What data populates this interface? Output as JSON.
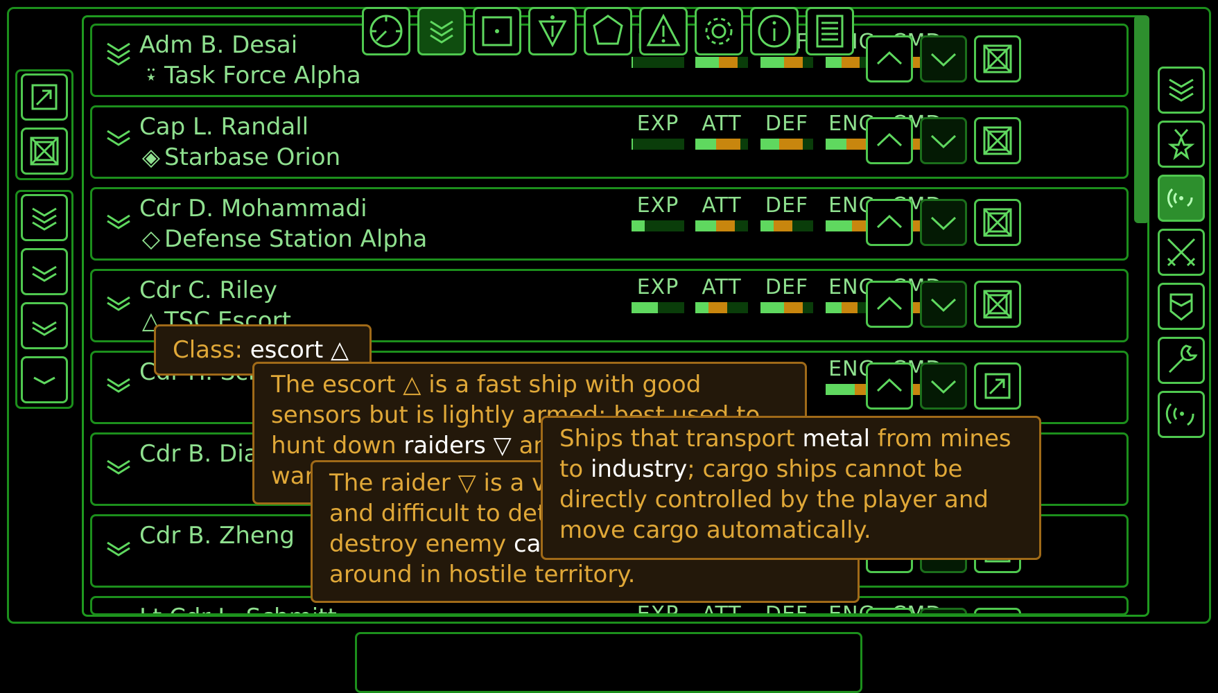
{
  "roster": [
    {
      "name": "Adm B. Desai",
      "unit_icon": "admiral-triangle-icon",
      "unit_glyph": "⍣",
      "unit": "Task Force Alpha",
      "chevron": "triple-chevron-icon",
      "last_button": "remove-square-icon",
      "stats": {
        "EXP": [
          0.02,
          0
        ],
        "ATT": [
          0.45,
          0.35
        ],
        "DEF": [
          0.45,
          0.35
        ],
        "ENG": [
          0.3,
          0.35
        ],
        "CMD": [
          0.35,
          0.35
        ]
      }
    },
    {
      "name": "Cap L. Randall",
      "unit_icon": "starbase-icon",
      "unit_glyph": "◈",
      "unit": "Starbase Orion",
      "chevron": "double-chevron-icon",
      "last_button": "remove-square-icon",
      "stats": {
        "EXP": [
          0.02,
          0
        ],
        "ATT": [
          0.4,
          0.45
        ],
        "DEF": [
          0.35,
          0.45
        ],
        "ENG": [
          0.4,
          0.45
        ],
        "CMD": [
          0.4,
          0.45
        ]
      }
    },
    {
      "name": "Cdr D. Mohammadi",
      "unit_icon": "defense-station-icon",
      "unit_glyph": "◇",
      "unit": "Defense Station Alpha",
      "chevron": "single-chevron-icon",
      "last_button": "remove-square-icon",
      "stats": {
        "EXP": [
          0.25,
          0
        ],
        "ATT": [
          0.4,
          0.35
        ],
        "DEF": [
          0.25,
          0.35
        ],
        "ENG": [
          0.5,
          0.35
        ],
        "CMD": [
          0.4,
          0.35
        ]
      }
    },
    {
      "name": "Cdr C. Riley",
      "unit_icon": "escort-icon",
      "unit_glyph": "△",
      "unit": "TSC Escort",
      "chevron": "single-chevron-icon",
      "last_button": "remove-square-icon",
      "stats": {
        "EXP": [
          0.5,
          0
        ],
        "ATT": [
          0.25,
          0.35
        ],
        "DEF": [
          0.45,
          0.35
        ],
        "ENG": [
          0.3,
          0.3
        ],
        "CMD": [
          0.35,
          0.3
        ]
      }
    },
    {
      "name": "Cdr H. Sch",
      "unit_icon": "",
      "unit_glyph": "",
      "unit": "",
      "chevron": "single-chevron-icon",
      "last_button": "assign-arrow-icon",
      "stats": {
        "ENG": [
          0.55,
          0.25
        ],
        "CMD": [
          0.35,
          0.35
        ]
      }
    },
    {
      "name": "Cdr B. Dias",
      "unit_icon": "",
      "unit_glyph": "",
      "unit": "",
      "chevron": "single-chevron-icon",
      "last_button": "assign-arrow-icon",
      "stats": {}
    },
    {
      "name": "Cdr B. Zheng",
      "unit_icon": "",
      "unit_glyph": "",
      "unit": "",
      "chevron": "single-chevron-icon",
      "last_button": "assign-arrow-icon",
      "stats": {}
    },
    {
      "name": "Lt Cdr L. Schmitt",
      "unit_icon": "",
      "unit_glyph": "",
      "unit": "",
      "chevron": "single-chevron-icon",
      "last_button": "assign-arrow-icon",
      "stats": {
        "EXP": [
          0,
          0
        ],
        "ATT": [
          0,
          0
        ],
        "DEF": [
          0,
          0
        ],
        "ENG": [
          0,
          0
        ],
        "CMD": [
          0,
          0
        ]
      }
    }
  ],
  "stat_labels": [
    "EXP",
    "ATT",
    "DEF",
    "ENG",
    "CMD"
  ],
  "left_toolbar": {
    "top_group": [
      "assign-arrow-icon",
      "remove-square-icon"
    ],
    "rank_filters": [
      "triple-chevron-icon",
      "double-chevron-icon",
      "single-chevron-icon",
      "chevron-icon"
    ]
  },
  "right_toolbar": [
    "rank-chevrons-icon",
    "medal-star-icon",
    "sensor-signal-icon",
    "crossed-swords-icon",
    "shield-icon",
    "wrench-icon",
    "radio-signal-icon"
  ],
  "right_active_index": 2,
  "bottom_toolbar": [
    "compass-icon",
    "rank-chevrons-icon",
    "system-square-icon",
    "admiral-icon",
    "planet-polygon-icon",
    "alert-triangle-icon",
    "settings-gear-icon",
    "info-icon",
    "log-document-icon"
  ],
  "bottom_active_index": 1,
  "tooltips": {
    "class_tip": {
      "label": "Class: ",
      "value": "escort △"
    },
    "escort_tip": {
      "p1": "The escort △ is a fast ship with good sensors but is lightly armed; best used to hunt down ",
      "h1": "raiders ▽",
      "p2": " and as an a co",
      "p3": "war"
    },
    "raider_tip": {
      "p1": "The raider ▽ is a ve",
      "p2": "and difficult to dete",
      "p3": "destroy enemy ",
      "h1": "carg",
      "p4": "around in hostile territory."
    },
    "cargo_tip": {
      "p1": "Ships that transport ",
      "h1": "metal",
      "p2": " from mines to ",
      "h2": "industry",
      "p3": "; cargo ships cannot be directly controlled by the player and move cargo automatically."
    }
  },
  "colors": {
    "accent": "#4fc84f",
    "frame": "#1c8f1c",
    "text": "#8fe08f",
    "bar_green": "#5fd85f",
    "bar_orange": "#c8860e",
    "tooltip_bg": "#23180a",
    "tooltip_border": "#a06a18",
    "tooltip_text": "#e0a838"
  }
}
